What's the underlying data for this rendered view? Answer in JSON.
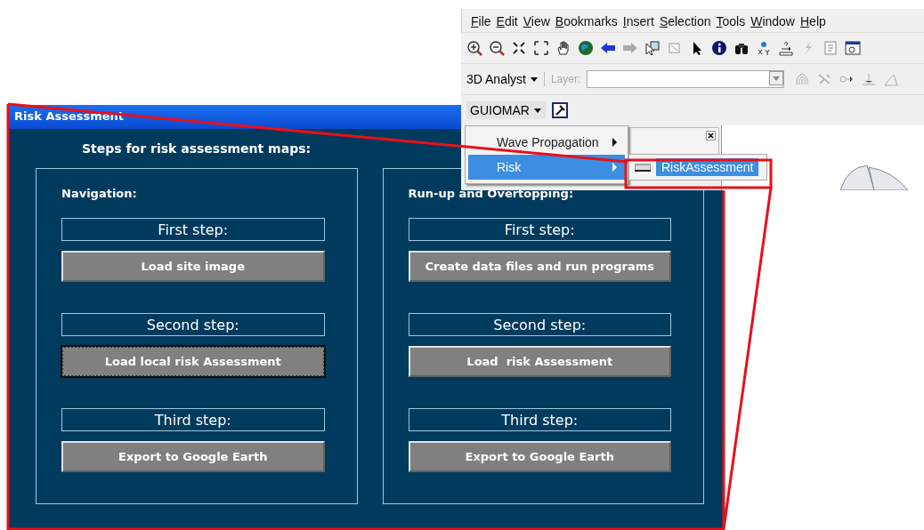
{
  "app": {
    "menu_bar": [
      "File",
      "Edit",
      "View",
      "Bookmarks",
      "Insert",
      "Selection",
      "Tools",
      "Window",
      "Help"
    ],
    "analyst_toolbar": {
      "dropdown": "3D Analyst",
      "layer_label": "Layer:",
      "disabled": true
    },
    "guiomar_toolbar": {
      "dropdown": "GUIOMAR"
    },
    "menu": [
      {
        "label": "Wave Propagation",
        "selected": false
      },
      {
        "label": "Risk",
        "selected": true
      }
    ],
    "submenu": [
      {
        "label": "RiskAssessment",
        "selected": true
      }
    ]
  },
  "dialog": {
    "title": "Risk Assessment",
    "heading": "Steps for risk assessment maps:",
    "groups": [
      {
        "title": "Navigation:",
        "steps": [
          {
            "label": "First step:",
            "button": "Load site image",
            "focused": false
          },
          {
            "label": "Second step:",
            "button": "Load local risk Assessment",
            "focused": true
          },
          {
            "label": "Third step:",
            "button": "Export to Google Earth",
            "focused": false
          }
        ]
      },
      {
        "title": "Run-up and Overtopping:",
        "steps": [
          {
            "label": "First step:",
            "button": "Create data files and run programs",
            "focused": false
          },
          {
            "label": "Second step:",
            "button": "Load  risk Assessment",
            "focused": false
          },
          {
            "label": "Third step:",
            "button": "Export to Google Earth",
            "focused": false
          }
        ]
      }
    ]
  }
}
